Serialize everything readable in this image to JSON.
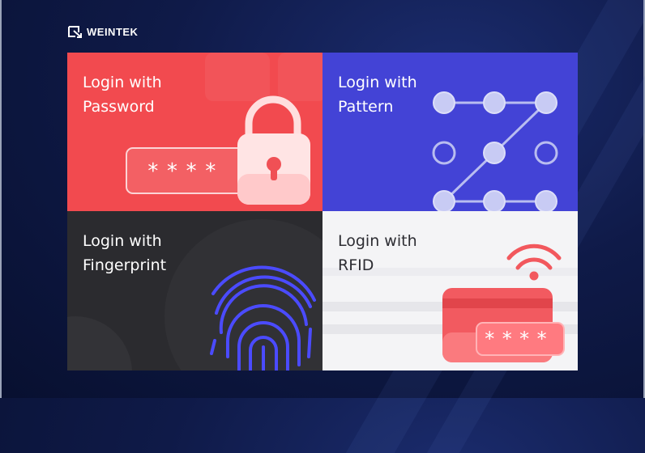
{
  "brand": {
    "logo_text": "WEINTEK"
  },
  "tiles": {
    "password": {
      "label": "Login with\nPassword",
      "mask": "****"
    },
    "pattern": {
      "label": "Login with\nPattern"
    },
    "fingerprint": {
      "label": "Login with\nFingerprint"
    },
    "rfid": {
      "label": "Login with\nRFID",
      "mask": "****"
    }
  },
  "colors": {
    "password_bg": "#f24a4f",
    "pattern_bg": "#4343d6",
    "fingerprint_bg": "#2b2b2f",
    "rfid_bg": "#f4f4f6",
    "accent_red": "#f05055"
  },
  "icons": [
    "weintek-logo-icon",
    "lock-icon",
    "pattern-grid-icon",
    "fingerprint-icon",
    "wifi-signal-icon",
    "card-icon"
  ]
}
